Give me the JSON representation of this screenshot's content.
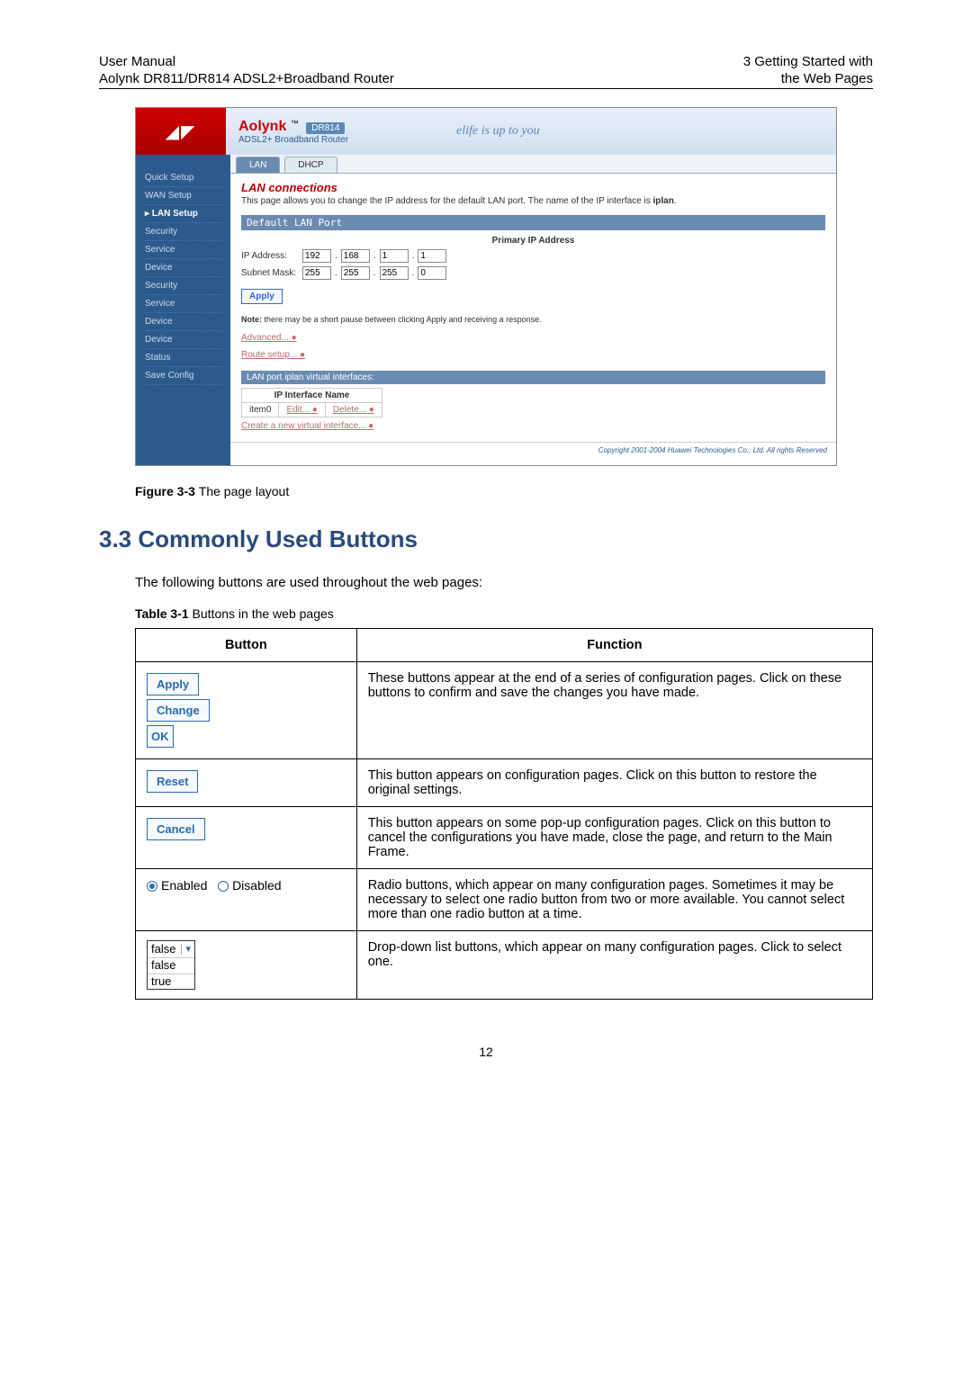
{
  "header": {
    "left1": "User Manual",
    "left2": "Aolynk DR811/DR814 ADSL2+Broadband Router",
    "right1": "3  Getting Started with",
    "right2": "the Web Pages"
  },
  "screenshot": {
    "brand": "Aolynk",
    "model": "DR814",
    "subtitle": "ADSL2+ Broadband Router",
    "slogan": "elife is up to you",
    "sidebar": [
      "Quick Setup",
      "WAN Setup",
      "LAN Setup",
      "Security",
      "Service",
      "Device",
      "Security",
      "Service",
      "Device",
      "Device",
      "Status",
      "Save Config"
    ],
    "active_sidebar": "LAN Setup",
    "tabs": [
      "LAN",
      "DHCP"
    ],
    "section_title": "LAN connections",
    "desc_prefix": "This page allows you to change the IP address for the default LAN port. The name of the IP interface is ",
    "desc_bold": "iplan",
    "subhead": "Default LAN Port",
    "ip_head": "Primary IP Address",
    "ip_label": "IP Address:",
    "mask_label": "Subnet Mask:",
    "ip": [
      "192",
      "168",
      "1",
      "1"
    ],
    "mask": [
      "255",
      "255",
      "255",
      "0"
    ],
    "apply": "Apply",
    "note_prefix": "Note: ",
    "note": "there may be a short pause between clicking Apply and receiving a response.",
    "link1": "Advanced...",
    "link2": "Route setup...",
    "vi_head": "LAN port iplan virtual interfaces:",
    "vi_th": "IP Interface Name",
    "vi_row": "item0",
    "vi_edit": "Edit...",
    "vi_delete": "Delete...",
    "vi_create": "Create a new virtual interface...",
    "copyright": "Copyright 2001-2004 Huawei Technologies Co., Ltd. All rights Reserved"
  },
  "fig_caption_bold": "Figure 3-3 ",
  "fig_caption": "The page layout",
  "section_heading": "3.3  Commonly Used Buttons",
  "intro": "The following buttons are used throughout the web pages:",
  "table_caption_bold": "Table 3-1 ",
  "table_caption": "Buttons in the web pages",
  "table": {
    "th1": "Button",
    "th2": "Function",
    "rows": [
      {
        "btns": [
          "Apply",
          "Change",
          "OK"
        ],
        "type": "buttons",
        "func": "These buttons appear at the end of a series of configuration pages. Click on these buttons to confirm and save the changes you have made."
      },
      {
        "btns": [
          "Reset"
        ],
        "type": "buttons",
        "func": "This button appears on configuration pages. Click on this button to restore the original settings."
      },
      {
        "btns": [
          "Cancel"
        ],
        "type": "buttons",
        "func": "This button appears on some pop-up configuration pages. Click on this button to cancel the configurations you have made, close the page, and return to the Main Frame."
      },
      {
        "radio": {
          "enabled": "Enabled",
          "disabled": "Disabled"
        },
        "type": "radio",
        "func": "Radio buttons, which appear on many configuration pages. Sometimes it may be necessary to select one radio button from two or more available. You cannot select more than one radio button at a time."
      },
      {
        "dropdown": {
          "sel": "false",
          "opts": [
            "false",
            "true"
          ]
        },
        "type": "dropdown",
        "func": "Drop-down list buttons, which appear on many configuration pages. Click to select one."
      }
    ]
  },
  "page_num": "12"
}
